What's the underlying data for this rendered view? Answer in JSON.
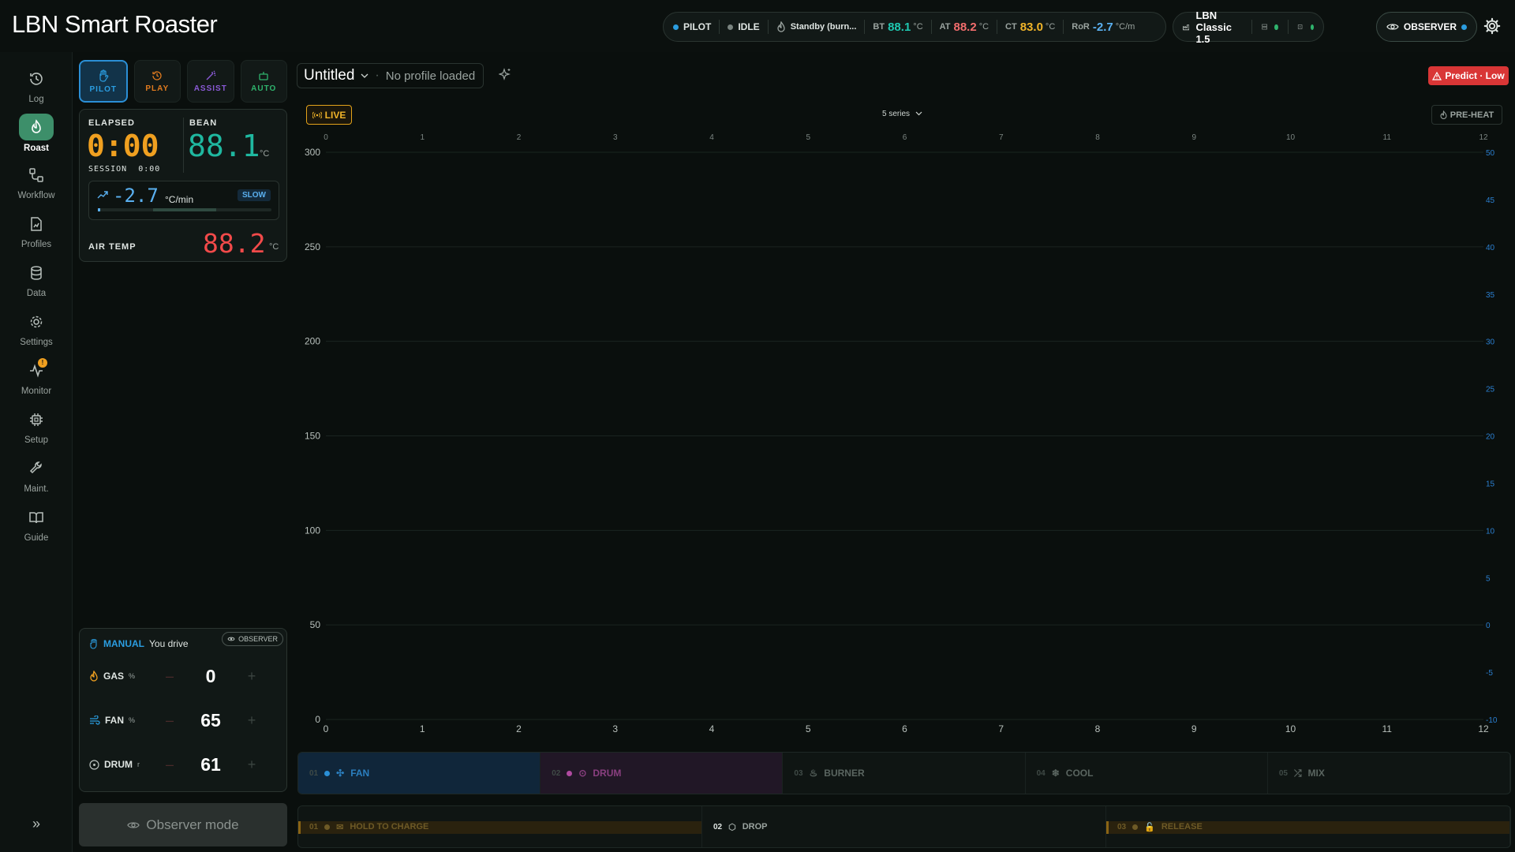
{
  "app": {
    "title": "LBN Smart Roaster"
  },
  "header": {
    "mode": "PILOT",
    "state": "IDLE",
    "burner": "Standby (burn...",
    "bt_label": "BT",
    "bt_value": "88.1",
    "at_label": "AT",
    "at_value": "88.2",
    "ct_label": "CT",
    "ct_value": "83.0",
    "unit": "°C",
    "ror_label": "RoR",
    "ror_value": "-2.7",
    "ror_unit": "°C/m",
    "machine": "LBN Classic 1.5",
    "observer": "OBSERVER"
  },
  "sidebar": {
    "items": [
      {
        "label": "Log",
        "icon": "history-icon"
      },
      {
        "label": "Roast",
        "icon": "flame-icon"
      },
      {
        "label": "Workflow",
        "icon": "workflow-icon"
      },
      {
        "label": "Profiles",
        "icon": "file-chart-icon"
      },
      {
        "label": "Data",
        "icon": "database-icon"
      },
      {
        "label": "Settings",
        "icon": "gear-icon"
      },
      {
        "label": "Monitor",
        "icon": "activity-icon",
        "badge": "!"
      },
      {
        "label": "Setup",
        "icon": "chip-icon"
      },
      {
        "label": "Maint.",
        "icon": "wrench-icon"
      },
      {
        "label": "Guide",
        "icon": "book-icon"
      }
    ],
    "expand": "»"
  },
  "modes": [
    {
      "label": "PILOT"
    },
    {
      "label": "PLAY"
    },
    {
      "label": "ASSIST"
    },
    {
      "label": "AUTO"
    }
  ],
  "readout": {
    "elapsed_label": "ELAPSED",
    "elapsed": "0:00",
    "session_label": "SESSION",
    "session": "0:00",
    "bean_label": "BEAN",
    "bean": "88.1",
    "unit": "°C",
    "ror": "-2.7",
    "ror_unit": "°C/min",
    "ror_badge": "SLOW",
    "air_label": "AIR TEMP",
    "air": "88.2"
  },
  "manual": {
    "title": "MANUAL",
    "subtitle": "You drive",
    "observer_badge": "OBSERVER",
    "controls": [
      {
        "name": "GAS",
        "unit": "%",
        "value": "0"
      },
      {
        "name": "FAN",
        "unit": "%",
        "value": "65"
      },
      {
        "name": "DRUM",
        "unit": "r",
        "value": "61"
      }
    ],
    "observer_btn": "Observer mode"
  },
  "profile": {
    "name": "Untitled",
    "sub": "No profile loaded"
  },
  "predict": "Predict · Low",
  "live": "LIVE",
  "series_sel": "5 series",
  "preheat": "PRE-HEAT",
  "chart_data": {
    "type": "line",
    "x_ticks": [
      "0",
      "1",
      "2",
      "3",
      "4",
      "5",
      "6",
      "7",
      "8",
      "9",
      "10",
      "11",
      "12"
    ],
    "y_left_ticks": [
      "300",
      "250",
      "200",
      "150",
      "100",
      "50",
      "0"
    ],
    "y_right_ticks": [
      "50",
      "45",
      "40",
      "35",
      "30",
      "25",
      "20",
      "15",
      "10",
      "5",
      "0",
      "-5",
      "-10"
    ],
    "xlim": [
      0,
      12
    ],
    "ylim": [
      0,
      300
    ],
    "y2lim": [
      -10,
      50
    ],
    "series": [],
    "grid": true
  },
  "phases": [
    {
      "n": "01",
      "label": "FAN",
      "color": "#2a8fd6"
    },
    {
      "n": "02",
      "label": "DRUM",
      "color": "#b04aa0"
    },
    {
      "n": "03",
      "label": "BURNER",
      "color": ""
    },
    {
      "n": "04",
      "label": "COOL",
      "color": ""
    },
    {
      "n": "05",
      "label": "MIX",
      "color": ""
    }
  ],
  "events": [
    {
      "n": "01",
      "label": "HOLD TO CHARGE"
    },
    {
      "n": "02",
      "label": "DROP"
    },
    {
      "n": "03",
      "label": "RELEASE"
    }
  ]
}
